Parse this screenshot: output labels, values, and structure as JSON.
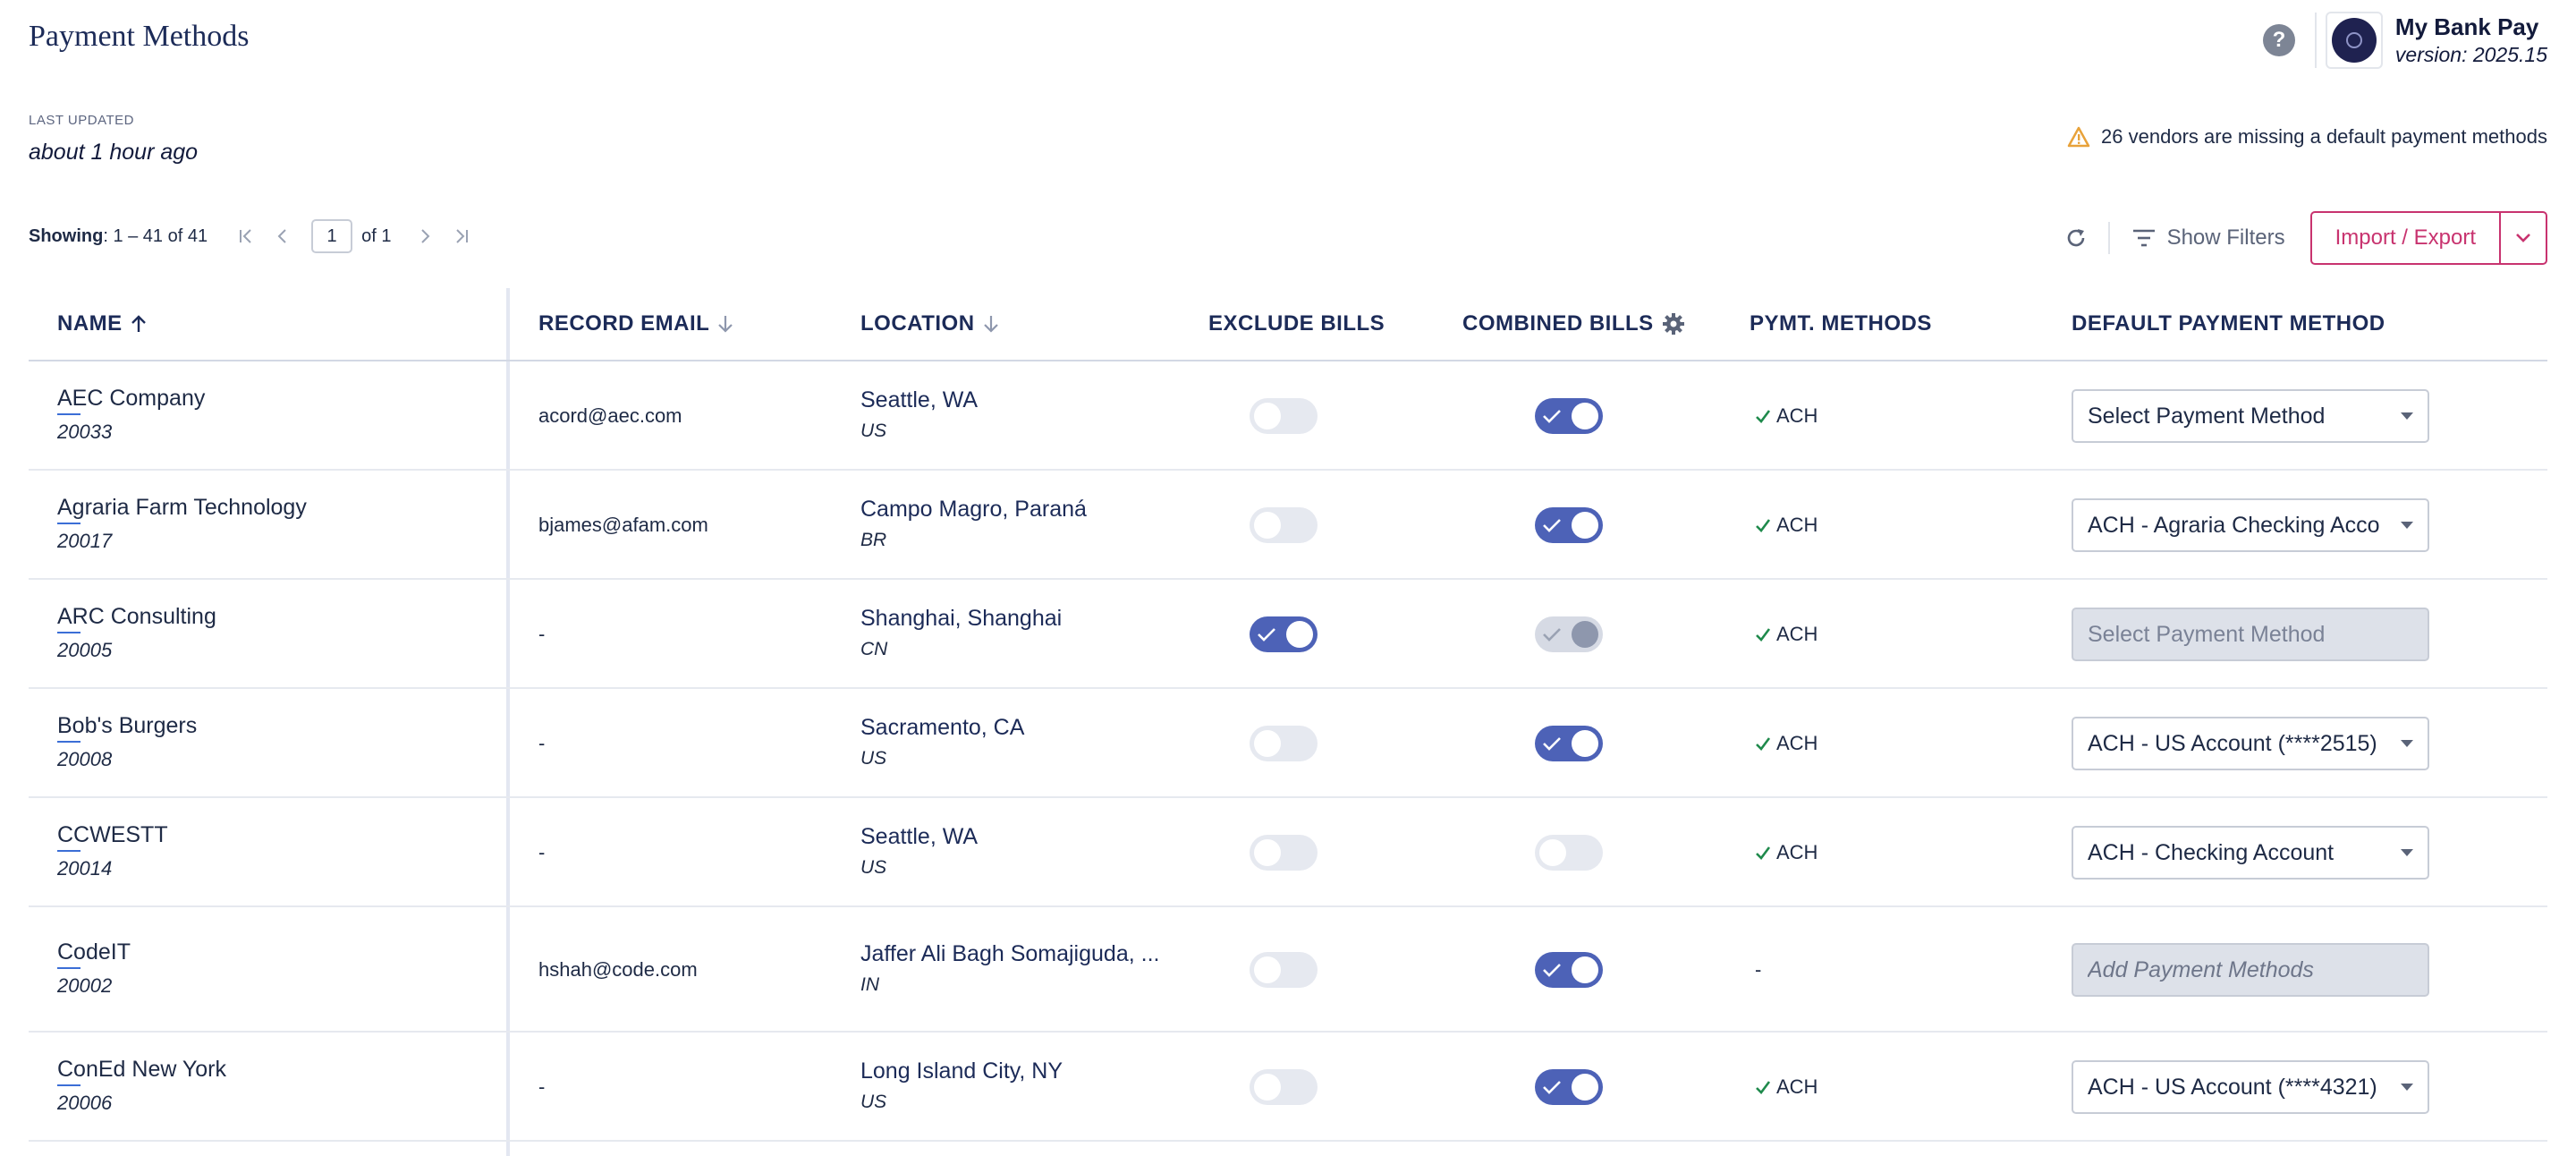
{
  "page": {
    "title": "Payment Methods",
    "last_updated_label": "LAST UPDATED",
    "last_updated_value": "about 1 hour ago"
  },
  "brand": {
    "name": "My Bank Pay",
    "version": "version: 2025.15",
    "help_icon": "question-circle-icon"
  },
  "warning": {
    "text": "26 vendors are missing a default payment methods",
    "icon": "warning-triangle-icon",
    "color": "#e8a23a"
  },
  "toolbar": {
    "showing_label": "Showing",
    "showing_range": ": 1 – 41 of 41",
    "page_value": "1",
    "of_pages": "of 1",
    "show_filters": "Show Filters",
    "import_export": "Import / Export"
  },
  "columns": {
    "name": "NAME",
    "record_email": "RECORD EMAIL",
    "location": "LOCATION",
    "exclude_bills": "EXCLUDE BILLS",
    "combined_bills": "COMBINED BILLS",
    "pymt_methods": "PYMT. METHODS",
    "default_payment_method": "DEFAULT PAYMENT METHOD"
  },
  "colors": {
    "accent": "#c8336f",
    "toggle_on": "#4d62b7",
    "title": "#1c2b58",
    "check": "#1f8a4c"
  },
  "rows": [
    {
      "name": "AEC Company",
      "id": "20033",
      "email": "acord@aec.com",
      "city": "Seattle, WA",
      "country": "US",
      "exclude": "off",
      "combined": "on",
      "pm": "ACH",
      "default": "Select Payment Method",
      "default_state": "normal"
    },
    {
      "name": "Agraria Farm Technology",
      "id": "20017",
      "email": "bjames@afam.com",
      "city": "Campo Magro, Paraná",
      "country": "BR",
      "exclude": "off",
      "combined": "on",
      "pm": "ACH",
      "default": "ACH - Agraria Checking Acco",
      "default_state": "normal"
    },
    {
      "name": "ARC Consulting",
      "id": "20005",
      "email": "-",
      "city": "Shanghai, Shanghai",
      "country": "CN",
      "exclude": "on",
      "combined": "disabled-on",
      "pm": "ACH",
      "default": "Select Payment Method",
      "default_state": "disabled"
    },
    {
      "name": "Bob's Burgers",
      "id": "20008",
      "email": "-",
      "city": "Sacramento, CA",
      "country": "US",
      "exclude": "off",
      "combined": "on",
      "pm": "ACH",
      "default": "ACH - US Account (****2515)",
      "default_state": "normal"
    },
    {
      "name": "CCWESTT",
      "id": "20014",
      "email": "-",
      "city": "Seattle, WA",
      "country": "US",
      "exclude": "off",
      "combined": "off",
      "pm": "ACH",
      "default": "ACH - Checking Account",
      "default_state": "normal"
    },
    {
      "name": "CodeIT",
      "id": "20002",
      "email": "hshah@code.com",
      "city": "Jaffer Ali Bagh Somajiguda, ...",
      "country": "IN",
      "exclude": "off",
      "combined": "on",
      "pm": "-",
      "default": "Add Payment Methods",
      "default_state": "add"
    },
    {
      "name": "ConEd New York",
      "id": "20006",
      "email": "-",
      "city": "Long Island City, NY",
      "country": "US",
      "exclude": "off",
      "combined": "on",
      "pm": "ACH",
      "default": "ACH - US Account (****4321)",
      "default_state": "normal"
    }
  ]
}
